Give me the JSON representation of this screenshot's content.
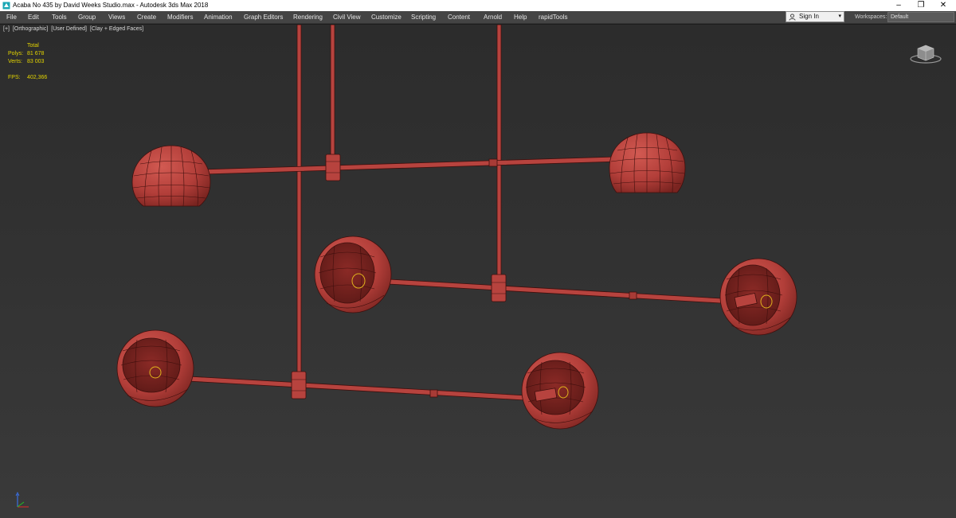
{
  "window": {
    "title": "Acaba No 435 by David Weeks Studio.max - Autodesk 3ds Max 2018",
    "controls": {
      "minimize": "–",
      "maximize": "❐",
      "close": "✕"
    }
  },
  "menu": [
    "File",
    "Edit",
    "Tools",
    "Group",
    "Views",
    "Create",
    "Modifiers",
    "Animation",
    "Graph Editors",
    "Rendering",
    "Civil View",
    "Customize",
    "Scripting",
    "Content",
    "Arnold",
    "Help",
    "rapidTools"
  ],
  "account": {
    "sign_in_label": "Sign In",
    "dropdown_arrow": "▾"
  },
  "workspaces": {
    "label": "Workspaces:",
    "selected": "Default"
  },
  "viewport": {
    "labels": [
      "[+]",
      "[Orthographic]",
      "[User Defined]",
      "[Clay + Edged Faces]"
    ],
    "stats": {
      "header": "Total",
      "polys_label": "Polys:",
      "polys_value": "81 678",
      "verts_label": "Verts:",
      "verts_value": "83 003",
      "fps_label": "FPS:",
      "fps_value": "402,366"
    },
    "colors": {
      "mesh": "#b7433e",
      "mesh_dark": "#6e1f1c",
      "wire": "#3f0f0d",
      "stats_text": "#e3d400",
      "bulb_wire": "#e0b21c"
    }
  }
}
